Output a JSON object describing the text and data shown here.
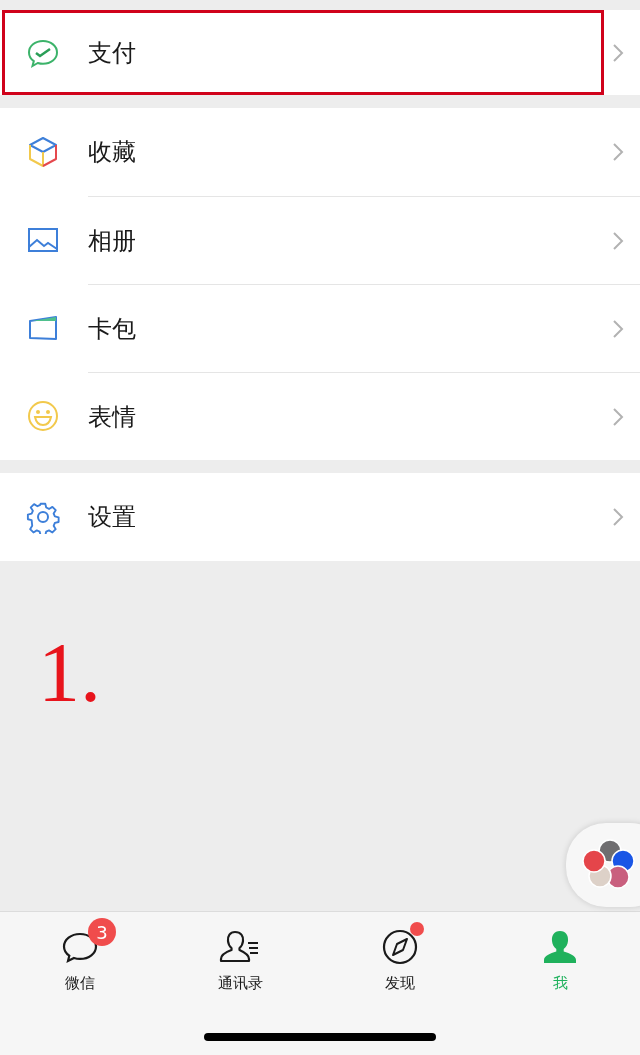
{
  "menu_groups": [
    {
      "items": [
        {
          "label": "支付",
          "highlighted": true
        }
      ]
    },
    {
      "items": [
        {
          "label": "收藏",
          "highlighted": false
        },
        {
          "label": "相册",
          "highlighted": false
        },
        {
          "label": "卡包",
          "highlighted": false
        },
        {
          "label": "表情",
          "highlighted": false
        }
      ]
    },
    {
      "items": [
        {
          "label": "设置",
          "highlighted": false
        }
      ]
    }
  ],
  "annotation": "1.",
  "tabs": [
    {
      "label": "微信",
      "selected": false,
      "badge": "3",
      "dot": false
    },
    {
      "label": "通讯录",
      "selected": false,
      "dot": false
    },
    {
      "label": "发现",
      "selected": false,
      "dot": true
    },
    {
      "label": "我",
      "selected": true,
      "dot": false
    }
  ]
}
